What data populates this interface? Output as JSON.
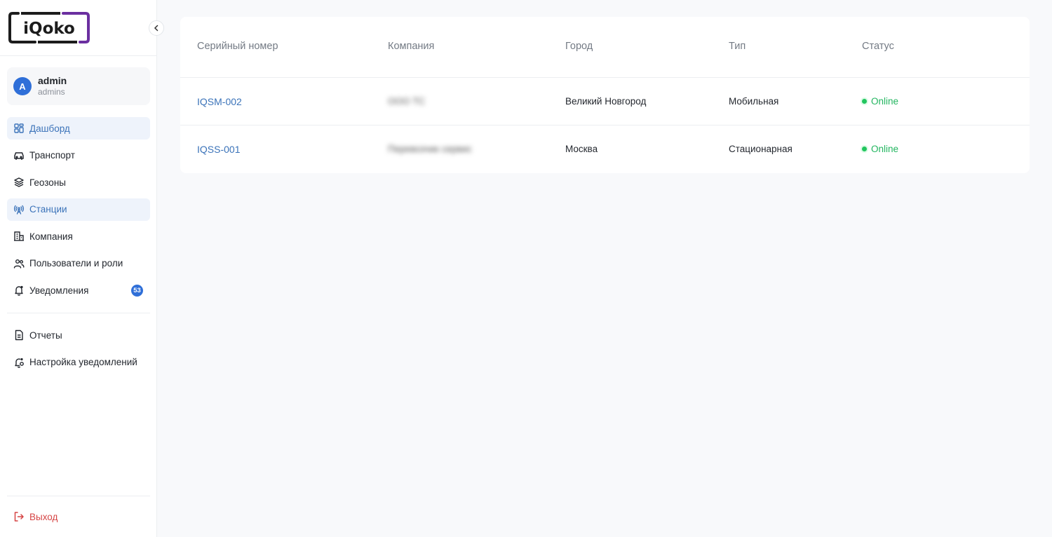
{
  "brand": {
    "logo_text": "iQoko",
    "accent": "#6b2fa0"
  },
  "user": {
    "avatar_letter": "A",
    "name": "admin",
    "role": "admins"
  },
  "nav": {
    "items": [
      {
        "label": "Дашборд",
        "icon": "dashboard-icon",
        "active": true
      },
      {
        "label": "Транспорт",
        "icon": "car-icon"
      },
      {
        "label": "Геозоны",
        "icon": "layers-icon"
      },
      {
        "label": "Станции",
        "icon": "antenna-icon",
        "active": true
      },
      {
        "label": "Компания",
        "icon": "building-icon"
      },
      {
        "label": "Пользователи и роли",
        "icon": "users-icon"
      },
      {
        "label": "Уведомления",
        "icon": "bell-icon",
        "badge": "53"
      }
    ],
    "secondary": [
      {
        "label": "Отчеты",
        "icon": "document-icon"
      },
      {
        "label": "Настройка уведомлений",
        "icon": "bell-settings-icon"
      }
    ],
    "logout": "Выход"
  },
  "table": {
    "headers": [
      "Серийный номер",
      "Компания",
      "Город",
      "Тип",
      "Статус"
    ],
    "rows": [
      {
        "serial": "IQSM-002",
        "company": "ООО ТС",
        "city": "Великий Новгород",
        "type": "Мобильная",
        "status": "Online"
      },
      {
        "serial": "IQSS-001",
        "company": "Перевозчик сервис",
        "city": "Москва",
        "type": "Стационарная",
        "status": "Online"
      }
    ]
  },
  "colors": {
    "link": "#3b73b9",
    "online": "#22b55f",
    "logout": "#d64545",
    "badge": "#2f6fd8"
  }
}
